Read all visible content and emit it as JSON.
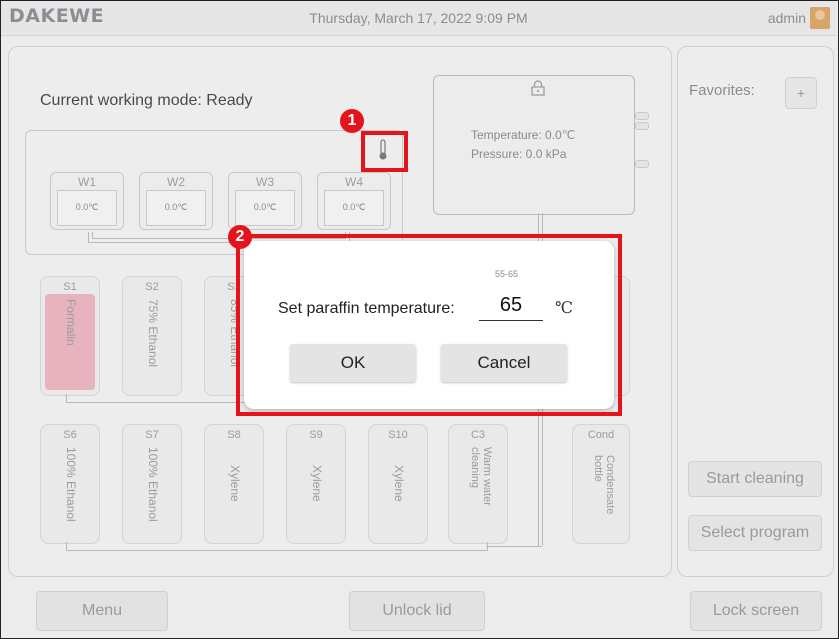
{
  "header": {
    "brand": "DAKEWE",
    "datetime": "Thursday, March 17, 2022 9:09 PM",
    "user": "admin"
  },
  "main": {
    "mode_label": "Current working mode: Ready",
    "wax_baths": [
      {
        "name": "W1",
        "temp": "0.0℃"
      },
      {
        "name": "W2",
        "temp": "0.0℃"
      },
      {
        "name": "W3",
        "temp": "0.0℃"
      },
      {
        "name": "W4",
        "temp": "0.0℃"
      }
    ],
    "retort": {
      "temperature": "Temperature: 0.0℃",
      "pressure": "Pressure: 0.0 kPa"
    },
    "bottles_row1": [
      {
        "name": "S1",
        "content": "Formalin"
      },
      {
        "name": "S2",
        "content": "75% Ethanol"
      },
      {
        "name": "S3",
        "content": "85% Ethanol"
      }
    ],
    "bottles_row2": [
      {
        "name": "S6",
        "content": "100% Ethanol"
      },
      {
        "name": "S7",
        "content": "100% Ethanol"
      },
      {
        "name": "S8",
        "content": "Xylene"
      },
      {
        "name": "S9",
        "content": "Xylene"
      },
      {
        "name": "S10",
        "content": "Xylene"
      },
      {
        "name": "C3",
        "content": "Warm water cleaning"
      },
      {
        "name": "Cond",
        "content": "Condensate bottle"
      }
    ]
  },
  "side": {
    "favorites": "Favorites:",
    "add": "+",
    "start_cleaning": "Start cleaning",
    "select_program": "Select program"
  },
  "footer": {
    "menu": "Menu",
    "unlock": "Unlock lid",
    "lock_screen": "Lock screen"
  },
  "dialog": {
    "range": "55-65",
    "label": "Set paraffin temperature:",
    "value": "65",
    "unit": "℃",
    "ok": "OK",
    "cancel": "Cancel"
  },
  "annotations": {
    "one": "1",
    "two": "2"
  },
  "colors": {
    "highlight": "#e3141b",
    "formalin": "#e6b3be"
  }
}
